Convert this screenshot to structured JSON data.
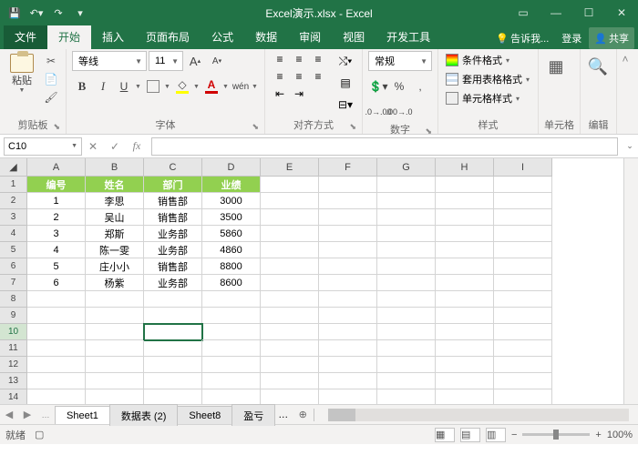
{
  "title": {
    "text": "Excel演示.xlsx - Excel"
  },
  "qat": {
    "save": "💾",
    "undo": "↶",
    "redo": "↷"
  },
  "tabs": {
    "file": "文件",
    "home": "开始",
    "insert": "插入",
    "layout": "页面布局",
    "formulas": "公式",
    "data": "数据",
    "review": "审阅",
    "view": "视图",
    "dev": "开发工具",
    "tell": "告诉我...",
    "login": "登录",
    "share": "共享"
  },
  "ribbon": {
    "clipboard": {
      "label": "剪贴板",
      "paste": "粘贴"
    },
    "font": {
      "label": "字体",
      "name": "等线",
      "size": "11",
      "grow": "A",
      "shrink": "A",
      "bold": "B",
      "italic": "I",
      "under": "U",
      "phonetic": "wén",
      "fontcolor": "A"
    },
    "align": {
      "label": "对齐方式"
    },
    "number": {
      "label": "数字",
      "format": "常规",
      "currency": "$",
      "percent": "%",
      "comma": ",",
      "inc": ".00",
      "dec": ".0"
    },
    "styles": {
      "label": "样式",
      "cond": "条件格式",
      "table": "套用表格格式",
      "cell": "单元格样式"
    },
    "cells": {
      "label": "单元格",
      "icon": "▦"
    },
    "editing": {
      "label": "编辑",
      "icon": "🔍"
    }
  },
  "namebox": "C10",
  "fx": "fx",
  "cols": [
    "A",
    "B",
    "C",
    "D",
    "E",
    "F",
    "G",
    "H",
    "I"
  ],
  "headers": {
    "a": "编号",
    "b": "姓名",
    "c": "部门",
    "d": "业绩"
  },
  "rows": [
    {
      "a": "1",
      "b": "李思",
      "c": "销售部",
      "d": "3000"
    },
    {
      "a": "2",
      "b": "吴山",
      "c": "销售部",
      "d": "3500"
    },
    {
      "a": "3",
      "b": "郑斯",
      "c": "业务部",
      "d": "5860"
    },
    {
      "a": "4",
      "b": "陈一雯",
      "c": "业务部",
      "d": "4860"
    },
    {
      "a": "5",
      "b": "庄小小",
      "c": "销售部",
      "d": "8800"
    },
    {
      "a": "6",
      "b": "杨紫",
      "c": "业务部",
      "d": "8600"
    }
  ],
  "sheets": {
    "s1": "Sheet1",
    "s2": "数据表 (2)",
    "s3": "Sheet8",
    "s4": "盈亏"
  },
  "status": {
    "ready": "就绪",
    "zoom": "100%"
  }
}
